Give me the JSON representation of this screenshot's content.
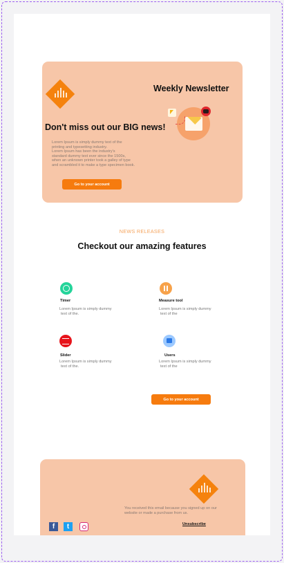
{
  "colors": {
    "accent": "#f67b0e",
    "panel": "#f7c6a8",
    "kicker": "#f5a35c",
    "background": "#f3f3f5"
  },
  "hero": {
    "logo_icon": "bar-chart-diamond-logo",
    "title": "Weekly Newsletter",
    "headline": "Don't miss out our BIG news!",
    "body_lines": [
      "Lorem Ipsum is simply dummy text of the",
      "printing and typesetting industry.",
      "Lorem Ipsum has been the industry's",
      "standard dummy text ever since the 1500s,",
      "when an unknown printer took a galley of type",
      "and scrambled it to make a type specimen book."
    ],
    "button_label": "Go to your account"
  },
  "features": {
    "kicker": "NEWS RELEASES",
    "title": "Checkout our amazing features",
    "items": [
      {
        "name": "Timer",
        "icon": "timer-icon",
        "desc_lines": [
          "Lorem Ipsum is simply dummy",
          "text of the."
        ]
      },
      {
        "name": "Measure tool",
        "icon": "measure-tool-icon",
        "desc_lines": [
          "Lorem Ipsum is simply dummy",
          "text of the"
        ]
      },
      {
        "name": "Slider",
        "icon": "slider-icon",
        "desc_lines": [
          "Lorem Ipsum is simply dummy",
          "text of the."
        ]
      },
      {
        "name": "Users",
        "icon": "users-icon",
        "desc_lines": [
          "Lorem Ipsum is simply dummy",
          "text of the"
        ]
      }
    ],
    "button_label": "Go to your account"
  },
  "footer": {
    "note_lines": [
      "You received this email because you signed up on our",
      "website or made a purchase from us."
    ],
    "unsubscribe": "Unsubscribe",
    "social": {
      "facebook": "f",
      "twitter": "t",
      "instagram": ""
    }
  }
}
